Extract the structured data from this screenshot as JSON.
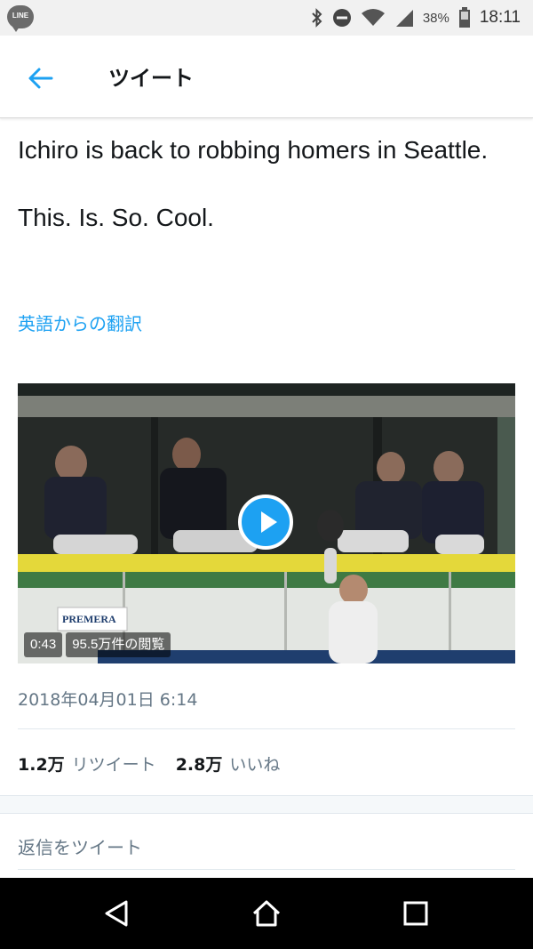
{
  "status_bar": {
    "app_icon_label": "LINE",
    "battery_percent": "38%",
    "time": "18:11"
  },
  "header": {
    "title": "ツイート"
  },
  "tweet": {
    "line1": "Ichiro is back to robbing homers in Seattle.",
    "line2": "This. Is. So. Cool.",
    "translate_link": "英語からの翻訳",
    "video": {
      "duration": "0:43",
      "views": "95.5万件の閲覧",
      "sign_brand": "PREMERA"
    },
    "timestamp": "2018年04月01日 6:14",
    "stats": {
      "retweet_count": "1.2万",
      "retweet_label": "リツイート",
      "like_count": "2.8万",
      "like_label": "いいね"
    },
    "reply_placeholder": "返信をツイート"
  },
  "colors": {
    "accent": "#1da1f2",
    "secondary_text": "#657786"
  }
}
